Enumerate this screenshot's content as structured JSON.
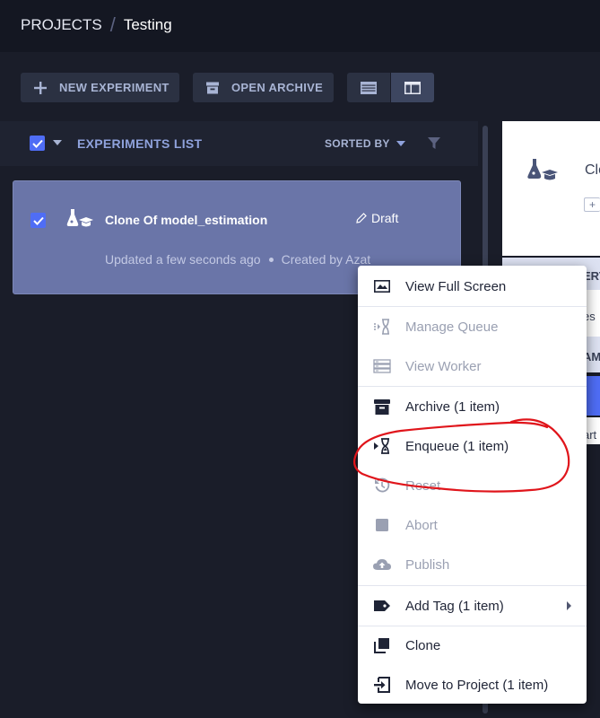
{
  "breadcrumb": {
    "root": "PROJECTS",
    "separator": "/",
    "current": "Testing"
  },
  "toolbar": {
    "new_experiment": "NEW EXPERIMENT",
    "open_archive": "OPEN ARCHIVE",
    "view_modes": [
      "table-view",
      "details-view"
    ],
    "active_view": "details-view"
  },
  "list": {
    "title": "EXPERIMENTS LIST",
    "sorted_by": "SORTED BY",
    "header_checked": true
  },
  "experiment": {
    "name": "Clone Of model_estimation",
    "status": "Draft",
    "updated": "Updated a few seconds ago",
    "created_by": "Created by Azat",
    "checked": true
  },
  "details_panel": {
    "title_partial": "Clo",
    "plus": "+",
    "band1_partial": "ERT",
    "row1_partial": "es",
    "band2_partial": "AM",
    "row2_partial": "art"
  },
  "context_menu": {
    "items": [
      {
        "label": "View Full Screen",
        "icon": "fullscreen-icon",
        "enabled": true
      },
      {
        "label": "Manage Queue",
        "icon": "queue-icon",
        "enabled": false
      },
      {
        "label": "View Worker",
        "icon": "worker-icon",
        "enabled": false
      },
      {
        "label": "Archive (1 item)",
        "icon": "archive-icon",
        "enabled": true
      },
      {
        "label": "Enqueue (1 item)",
        "icon": "enqueue-icon",
        "enabled": true
      },
      {
        "label": "Reset",
        "icon": "reset-icon",
        "enabled": false
      },
      {
        "label": "Abort",
        "icon": "abort-icon",
        "enabled": false
      },
      {
        "label": "Publish",
        "icon": "publish-icon",
        "enabled": false
      },
      {
        "label": "Add Tag (1 item)",
        "icon": "tag-icon",
        "enabled": true,
        "submenu": true
      },
      {
        "label": "Clone",
        "icon": "clone-icon",
        "enabled": true
      },
      {
        "label": "Move to Project (1 item)",
        "icon": "move-icon",
        "enabled": true
      }
    ]
  },
  "colors": {
    "background": "#1a1d29",
    "topbar": "#141722",
    "accent": "#4f6df5",
    "card_selected": "#6a75a8",
    "annotation": "#e0151b"
  }
}
